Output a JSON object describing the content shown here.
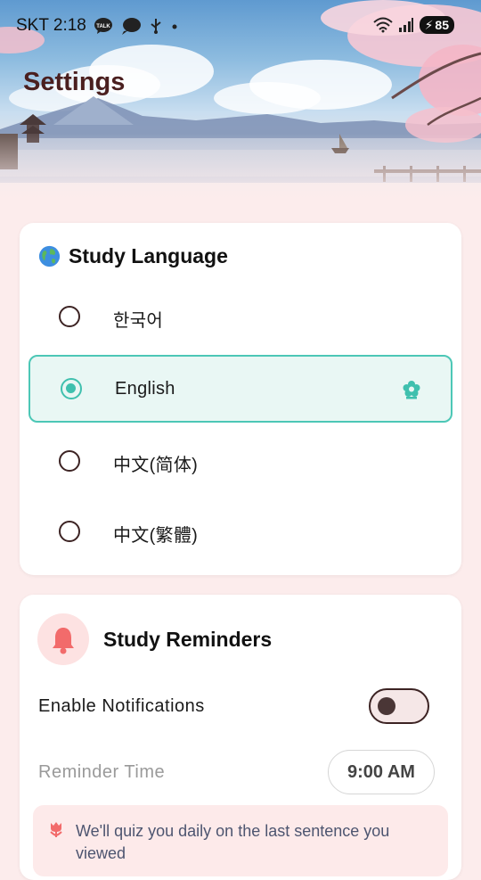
{
  "status_bar": {
    "carrier_time": "SKT 2:18",
    "battery": "85",
    "icons": [
      "talk-icon",
      "chat-bubble-icon",
      "usb-icon",
      "dot-icon",
      "wifi-icon",
      "signal-icon",
      "battery-charging-icon"
    ]
  },
  "header": {
    "title": "Settings"
  },
  "study_language": {
    "title": "Study Language",
    "icon": "globe-icon",
    "options": [
      {
        "label": "한국어",
        "selected": false
      },
      {
        "label": "English",
        "selected": true
      },
      {
        "label": "中文(简体)",
        "selected": false
      },
      {
        "label": "中文(繁體)",
        "selected": false
      }
    ]
  },
  "study_reminders": {
    "title": "Study Reminders",
    "icon": "bell-icon",
    "notifications_label": "Enable Notifications",
    "notifications_enabled": false,
    "reminder_time_label": "Reminder Time",
    "reminder_time_value": "9:00 AM",
    "info_text": "We'll quiz you daily on the last sentence you viewed"
  },
  "colors": {
    "accent": "#3fc0ae",
    "title": "#4a1f1f",
    "background": "#fcecec",
    "bell": "#f26b6b"
  }
}
